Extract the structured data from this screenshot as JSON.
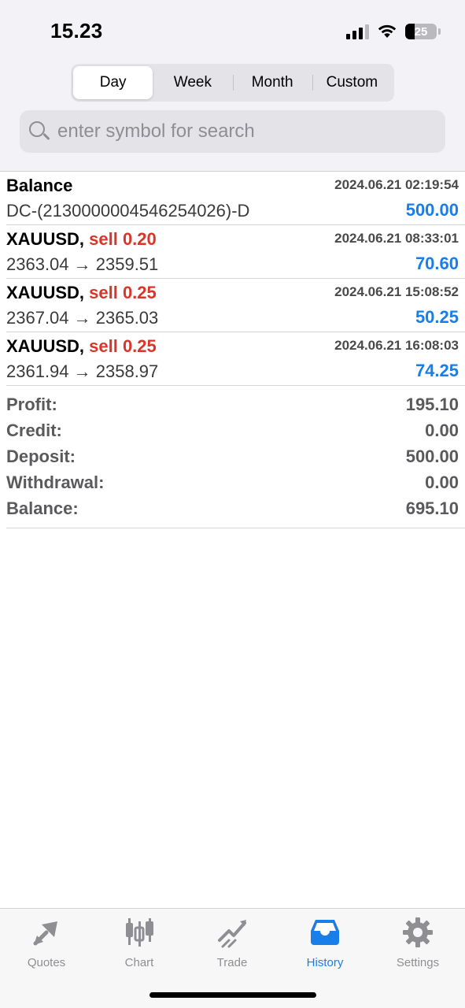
{
  "status_bar": {
    "time": "15.23",
    "battery": "25"
  },
  "segments": [
    {
      "label": "Day",
      "active": true
    },
    {
      "label": "Week",
      "active": false
    },
    {
      "label": "Month",
      "active": false
    },
    {
      "label": "Custom",
      "active": false
    }
  ],
  "search": {
    "placeholder": "enter symbol for search",
    "value": ""
  },
  "deals": [
    {
      "title": "Balance",
      "type": "",
      "time": "2024.06.21 02:19:54",
      "detail": "DC-(2130000004546254026)-D",
      "amount": "500.00"
    },
    {
      "title": "XAUUSD,",
      "type": "sell 0.20",
      "time": "2024.06.21 08:33:01",
      "detail": "2363.04 → 2359.51",
      "amount": "70.60"
    },
    {
      "title": "XAUUSD,",
      "type": "sell 0.25",
      "time": "2024.06.21 15:08:52",
      "detail": "2367.04 → 2365.03",
      "amount": "50.25"
    },
    {
      "title": "XAUUSD,",
      "type": "sell 0.25",
      "time": "2024.06.21 16:08:03",
      "detail": "2361.94 → 2358.97",
      "amount": "74.25"
    }
  ],
  "summary": {
    "profit_label": "Profit:",
    "profit": "195.10",
    "credit_label": "Credit:",
    "credit": "0.00",
    "deposit_label": "Deposit:",
    "deposit": "500.00",
    "withdrawal_label": "Withdrawal:",
    "withdrawal": "0.00",
    "balance_label": "Balance:",
    "balance": "695.10"
  },
  "tabs": [
    {
      "label": "Quotes",
      "icon": "quotes-arrows-icon",
      "active": false
    },
    {
      "label": "Chart",
      "icon": "candlestick-chart-icon",
      "active": false
    },
    {
      "label": "Trade",
      "icon": "trade-chart-icon",
      "active": false
    },
    {
      "label": "History",
      "icon": "inbox-tray-icon",
      "active": true
    },
    {
      "label": "Settings",
      "icon": "gear-icon",
      "active": false
    }
  ],
  "colors": {
    "accent": "#1a7ee8",
    "sell": "#d8362a",
    "inactive_tab": "#8e8e93"
  }
}
